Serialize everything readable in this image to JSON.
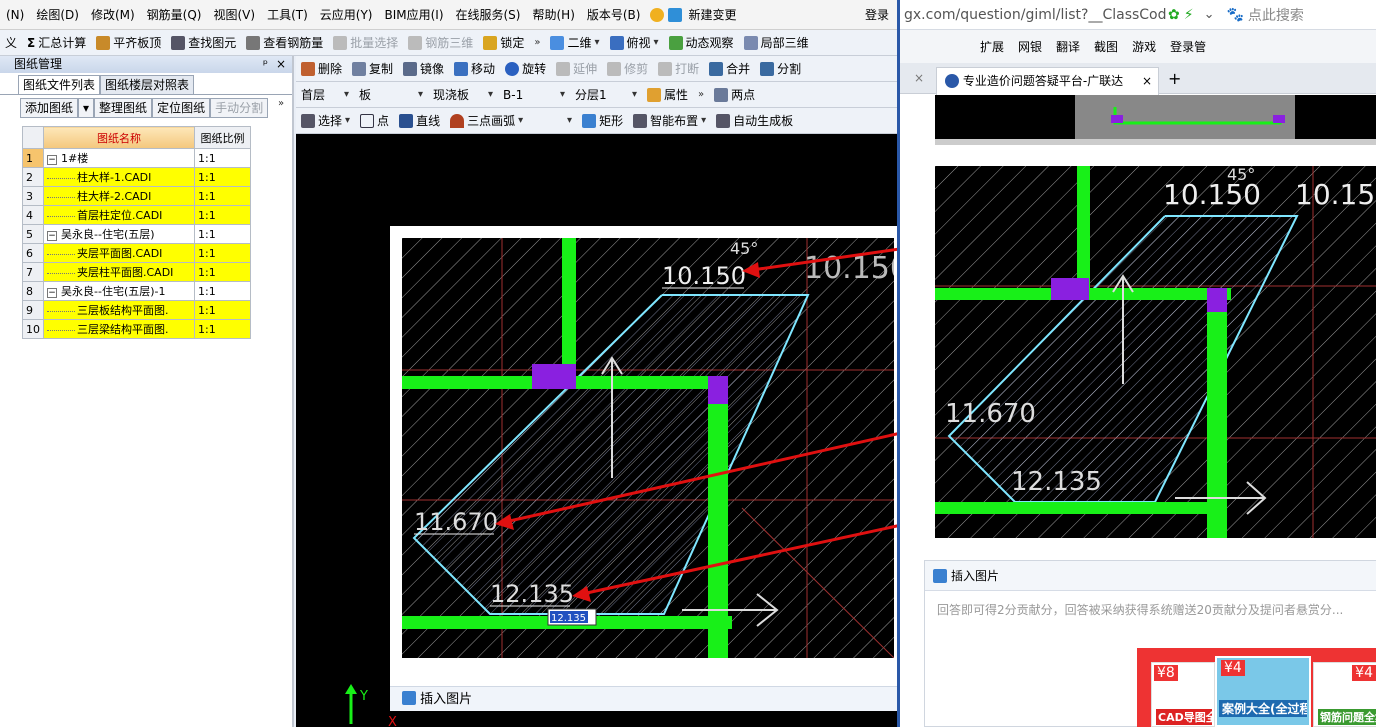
{
  "menu": {
    "items": [
      "(N)",
      "绘图(D)",
      "修改(M)",
      "钢筋量(Q)",
      "视图(V)",
      "工具(T)",
      "云应用(Y)",
      "BIM应用(I)",
      "在线服务(S)",
      "帮助(H)",
      "版本号(B)",
      "新建变更"
    ],
    "login": "登录"
  },
  "toolbar1": {
    "items": [
      "义",
      "汇总计算",
      "平齐板顶",
      "查找图元",
      "查看钢筋量",
      "批量选择",
      "钢筋三维",
      "锁定",
      "二维",
      "俯视",
      "动态观察",
      "局部三维"
    ],
    "sigma": "Σ"
  },
  "toolbar2": {
    "items": [
      "删除",
      "复制",
      "镜像",
      "移动",
      "旋转",
      "延伸",
      "修剪",
      "打断",
      "合并",
      "分割"
    ]
  },
  "toolbar3": {
    "floor": "首层",
    "type": "板",
    "subtype": "现浇板",
    "name": "B-1",
    "layer": "分层1",
    "props": "属性",
    "twopoint": "两点"
  },
  "toolbar4": {
    "items": [
      "选择",
      "点",
      "直线",
      "三点画弧",
      "矩形",
      "智能布置",
      "自动生成板"
    ]
  },
  "panel": {
    "title": "图纸管理",
    "pin": "ᵖ",
    "close": "×",
    "tabs": [
      "图纸文件列表",
      "图纸楼层对照表"
    ],
    "buttons": [
      "添加图纸",
      "整理图纸",
      "定位图纸",
      "手动分割"
    ],
    "col_name": "图纸名称",
    "col_scale": "图纸比例",
    "rows": [
      {
        "n": "1",
        "name": "1#楼",
        "scale": "1:1",
        "group": true,
        "y": false
      },
      {
        "n": "2",
        "name": "柱大样-1.CADI",
        "scale": "1:1",
        "group": false,
        "y": true
      },
      {
        "n": "3",
        "name": "柱大样-2.CADI",
        "scale": "1:1",
        "group": false,
        "y": true
      },
      {
        "n": "4",
        "name": "首层柱定位.CADI",
        "scale": "1:1",
        "group": false,
        "y": true
      },
      {
        "n": "5",
        "name": "吴永良--住宅(五层)",
        "scale": "1:1",
        "group": true,
        "y": false
      },
      {
        "n": "6",
        "name": "夹层平面图.CADI",
        "scale": "1:1",
        "group": false,
        "y": true
      },
      {
        "n": "7",
        "name": "夹层柱平面图.CADI",
        "scale": "1:1",
        "group": false,
        "y": true
      },
      {
        "n": "8",
        "name": "吴永良--住宅(五层)-1",
        "scale": "1:1",
        "group": true,
        "y": false
      },
      {
        "n": "9",
        "name": "三层板结构平面图.",
        "scale": "1:1",
        "group": false,
        "y": true
      },
      {
        "n": "10",
        "name": "三层梁结构平面图.",
        "scale": "1:1",
        "group": false,
        "y": true
      }
    ]
  },
  "cad": {
    "angle": "45°",
    "elev_top": "10.150",
    "elev_top2": "10.150",
    "elev_left": "11.670",
    "elev_bottom": "12.135",
    "input_value": "12.135",
    "axis_y": "Y",
    "axis_x": "X"
  },
  "insert_image": "插入图片",
  "browser": {
    "url": "gx.com/question/giml/list?__ClassCode=-",
    "search_placeholder": "点此搜索",
    "tools": [
      "扩展",
      "网银",
      "翻译",
      "截图",
      "游戏",
      "登录管"
    ],
    "tab_title": "专业造价问题答疑平台-广联达",
    "tab_close": "×",
    "new_tab": "+",
    "answer_placeholder": "回答即可得2分贡献分，回答被采纳获得系统赠送20贡献分及提问者悬赏分...",
    "ads": [
      "CAD导图全解",
      "案例大全(全过程)",
      "钢筋问题全集"
    ],
    "ad_badges": [
      "¥8",
      "¥4",
      "¥4"
    ]
  },
  "colors": {
    "green": "#18f018",
    "purple": "#8a20e0",
    "cyan": "#7fe6ff",
    "arrow": "#e01010",
    "yellow": "#ffff00"
  }
}
